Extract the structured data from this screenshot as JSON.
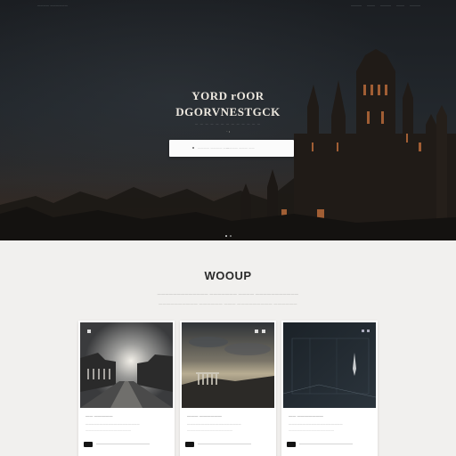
{
  "nav": {
    "brand": "———— ——————",
    "links": [
      "————",
      "———",
      "————",
      "———",
      "————"
    ]
  },
  "hero": {
    "title_line1": "YORD rOOR",
    "title_line2": "DGORVNESTGCK",
    "subtitle": "— — — — — — — — — — — — —",
    "dots": "·  ı",
    "search_placeholder": "———— ———— ——",
    "search_placeholder2": "———— ——— ——",
    "pager_dots": 2
  },
  "section": {
    "title": "WOOUP",
    "line1": "————————————— ——————— ———— ———————————",
    "line2": "—————————— —————— ——— ————————— ——————"
  },
  "cards": [
    {
      "title": "—— —————",
      "line1": "———————————————————",
      "line2": "————————————————"
    },
    {
      "title": "——— ——————",
      "line1": "———————————————————",
      "line2": "————————————————"
    },
    {
      "title": "—— ———————",
      "line1": "———————————————————",
      "line2": "————————————————"
    }
  ],
  "colors": {
    "hero_bg": "#1b1e22",
    "section_bg": "#f1f0ee",
    "card_bg": "#ffffff",
    "title_light": "#ece7de",
    "title_dark": "#2a2a2a",
    "accent_warm": "#b86a3a"
  }
}
